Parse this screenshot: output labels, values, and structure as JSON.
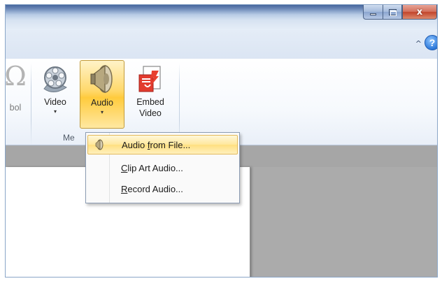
{
  "ribbon": {
    "symbol_label": "bol",
    "video_label": "Video",
    "audio_label": "Audio",
    "embed_label_line1": "Embed",
    "embed_label_line2": "Video",
    "group_label": "Me",
    "dropdown_arrow": "▾"
  },
  "window": {
    "collapse_ribbon_glyph": "^",
    "help_glyph": "?",
    "close_glyph": "x"
  },
  "audio_menu": {
    "items": [
      {
        "pre": "Audio ",
        "access": "f",
        "post": "rom File...",
        "highlighted": true
      },
      {
        "pre": "",
        "access": "C",
        "post": "lip Art Audio...",
        "highlighted": false
      },
      {
        "pre": "",
        "access": "R",
        "post": "ecord Audio...",
        "highlighted": false
      }
    ]
  },
  "colors": {
    "ribbon_bg": "#f6f9fd",
    "highlight": "#ffdf80",
    "workspace": "#ababab"
  }
}
